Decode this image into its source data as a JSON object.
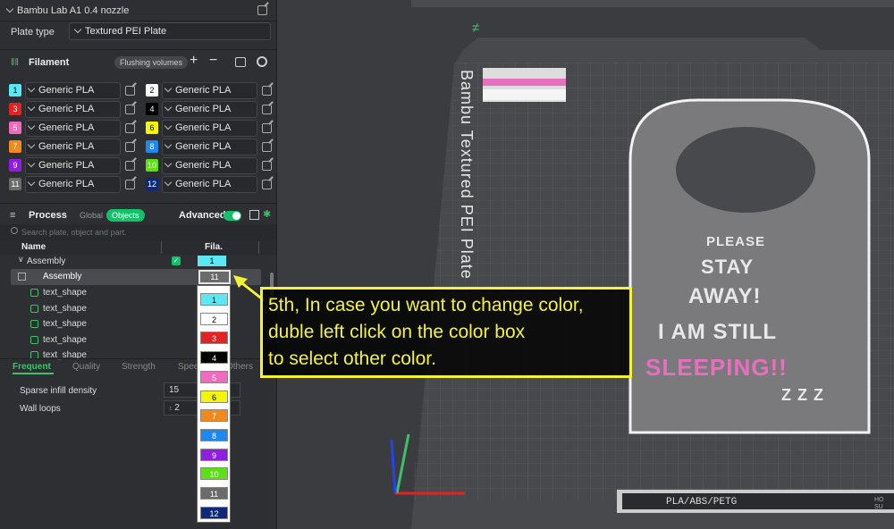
{
  "printer": {
    "name": "Bambu Lab A1 0.4 nozzle"
  },
  "plate": {
    "label": "Plate type",
    "value": "Textured PEI Plate"
  },
  "filament": {
    "title": "Filament",
    "flushing_label": "Flushing volumes",
    "items": [
      {
        "num": "1",
        "color": "#5ce8f2",
        "name": "Generic PLA"
      },
      {
        "num": "2",
        "color": "#ffffff",
        "name": "Generic PLA"
      },
      {
        "num": "3",
        "color": "#e52222",
        "name": "Generic PLA"
      },
      {
        "num": "4",
        "color": "#000000",
        "name": "Generic PLA"
      },
      {
        "num": "5",
        "color": "#f06ac0",
        "name": "Generic PLA"
      },
      {
        "num": "6",
        "color": "#f5f50a",
        "name": "Generic PLA"
      },
      {
        "num": "7",
        "color": "#f28a1b",
        "name": "Generic PLA"
      },
      {
        "num": "8",
        "color": "#1e88f0",
        "name": "Generic PLA"
      },
      {
        "num": "9",
        "color": "#8f1ee0",
        "name": "Generic PLA"
      },
      {
        "num": "10",
        "color": "#5ce016",
        "name": "Generic PLA"
      },
      {
        "num": "11",
        "color": "#6b6b6b",
        "name": "Generic PLA"
      },
      {
        "num": "12",
        "color": "#0d2a7a",
        "name": "Generic PLA"
      }
    ]
  },
  "process": {
    "title": "Process",
    "global_label": "Global",
    "objects_label": "Objects",
    "advanced_label": "Advanced",
    "search_placeholder": "Search plate, object and part."
  },
  "tree": {
    "col_name": "Name",
    "col_fila": "Fila.",
    "group": {
      "name": "Assembly",
      "fila": "1"
    },
    "selected": {
      "name": "Assembly",
      "fila": "11"
    },
    "children": [
      "text_shape",
      "text_shape",
      "text_shape",
      "text_shape",
      "text_shape"
    ]
  },
  "tabs": [
    "Frequent",
    "Quality",
    "Strength",
    "Speed",
    "Others"
  ],
  "settings": [
    {
      "label": "Sparse infill density",
      "value": "15"
    },
    {
      "label": "Wall loops",
      "value": "2"
    }
  ],
  "color_list": [
    {
      "num": "1",
      "color": "#5ce8f2"
    },
    {
      "num": "2",
      "color": "#ffffff"
    },
    {
      "num": "3",
      "color": "#e52222"
    },
    {
      "num": "4",
      "color": "#000000"
    },
    {
      "num": "5",
      "color": "#f06ac0"
    },
    {
      "num": "6",
      "color": "#f5f50a"
    },
    {
      "num": "7",
      "color": "#f28a1b"
    },
    {
      "num": "8",
      "color": "#1e88f0"
    },
    {
      "num": "9",
      "color": "#8f1ee0"
    },
    {
      "num": "10",
      "color": "#5ce016"
    },
    {
      "num": "11",
      "color": "#6b6b6b"
    },
    {
      "num": "12",
      "color": "#0d2a7a"
    }
  ],
  "callout": {
    "line1": "5th, In case you want to change color,",
    "line2": "duble left click on the color box",
    "line3": " to select other color."
  },
  "plate_view": {
    "bed_label": "Bambu Textured PEI Plate",
    "sign_lines": [
      "PLEASE",
      "STAY",
      "AWAY!",
      "I AM STILL",
      "SLEEPING!!",
      "Z Z Z"
    ],
    "bottom_label": "PLA/ABS/PETG",
    "bottom_right": "HO SU"
  },
  "accent": "#14c06a",
  "callout_color": "#f6f335"
}
